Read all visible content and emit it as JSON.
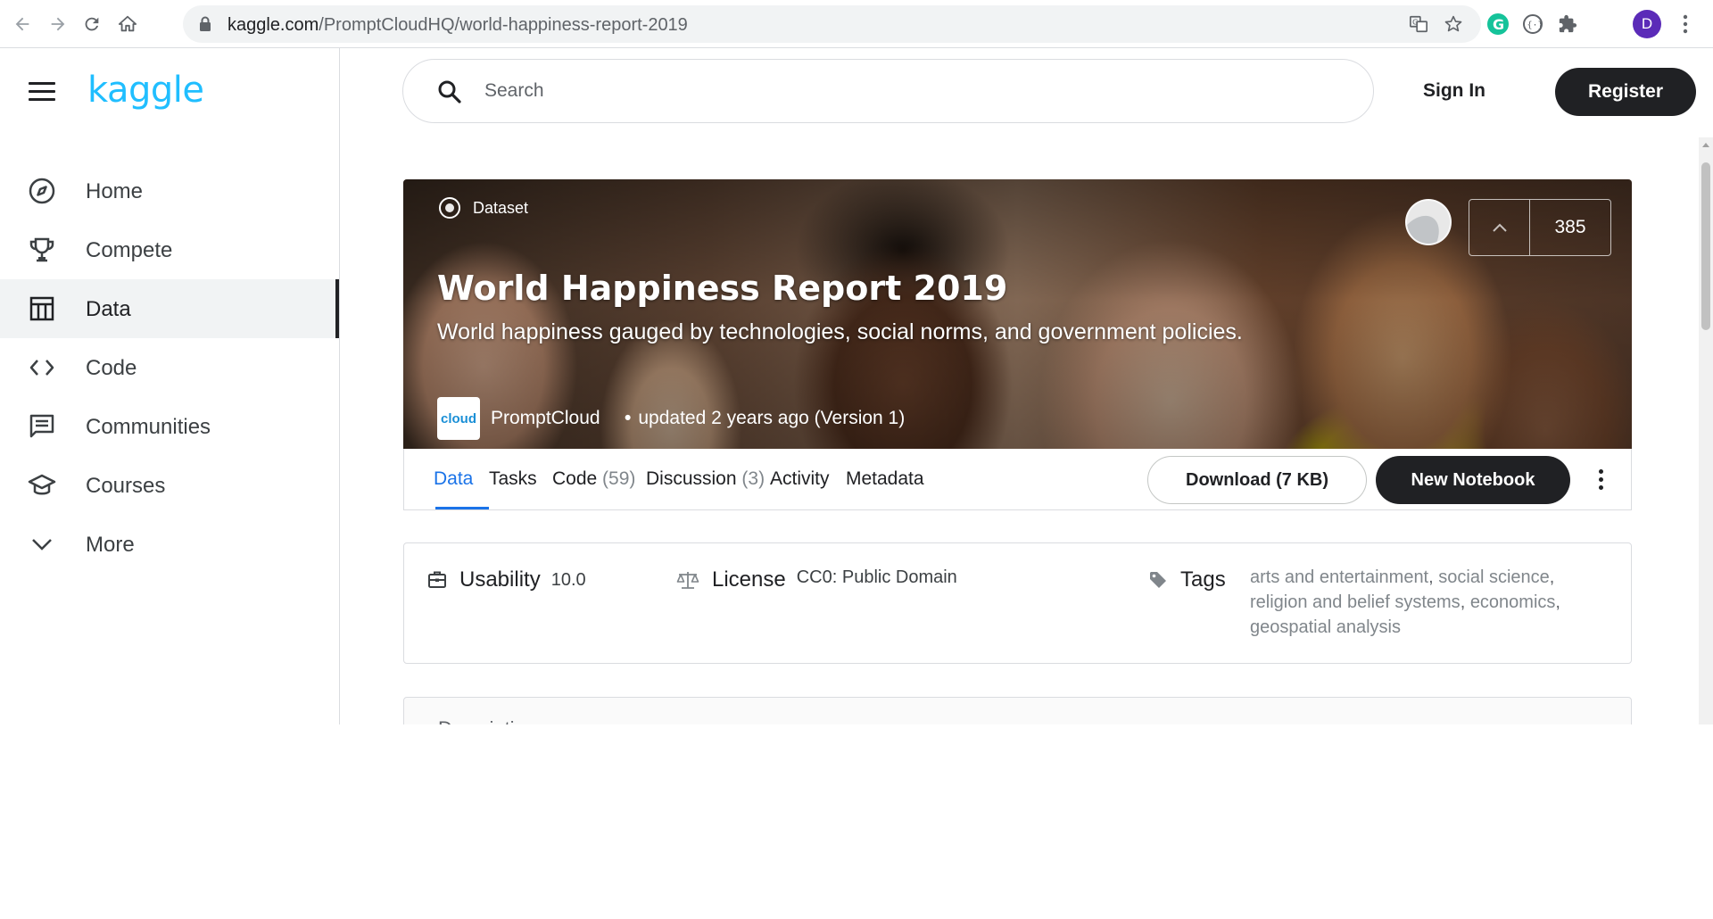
{
  "browser": {
    "url_host": "kaggle.com",
    "url_path": "/PromptCloudHQ/world-happiness-report-2019",
    "avatar_letter": "D"
  },
  "sidebar": {
    "logo": "kaggle",
    "items": [
      {
        "label": "Home",
        "icon": "compass-icon"
      },
      {
        "label": "Compete",
        "icon": "trophy-icon"
      },
      {
        "label": "Data",
        "icon": "table-icon",
        "active": true
      },
      {
        "label": "Code",
        "icon": "code-brackets-icon"
      },
      {
        "label": "Communities",
        "icon": "chat-icon"
      },
      {
        "label": "Courses",
        "icon": "graduation-cap-icon"
      },
      {
        "label": "More",
        "icon": "chevron-down-icon"
      }
    ]
  },
  "topbar": {
    "search_placeholder": "Search",
    "signin_label": "Sign In",
    "register_label": "Register"
  },
  "dataset": {
    "type_label": "Dataset",
    "title": "World Happiness Report 2019",
    "subtitle": "World happiness gauged by technologies, social norms, and government policies.",
    "owner": "PromptCloud",
    "owner_logo_text": "cloud",
    "updated": "updated 2 years ago (Version 1)",
    "votes": "385"
  },
  "tabs": [
    {
      "label": "Data",
      "count": ""
    },
    {
      "label": "Tasks",
      "count": ""
    },
    {
      "label": "Code",
      "count": "(59)"
    },
    {
      "label": "Discussion",
      "count": "(3)"
    },
    {
      "label": "Activity",
      "count": ""
    },
    {
      "label": "Metadata",
      "count": ""
    }
  ],
  "actions": {
    "download_label": "Download (7 KB)",
    "new_notebook_label": "New Notebook"
  },
  "meta": {
    "usability_label": "Usability",
    "usability_value": "10.0",
    "license_label": "License",
    "license_value": "CC0: Public Domain",
    "tags_label": "Tags",
    "tags": [
      "arts and entertainment",
      "social science",
      "religion and belief systems",
      "economics",
      "geospatial analysis"
    ]
  },
  "description": {
    "title": "Description"
  },
  "colors": {
    "kaggle_blue": "#20beff",
    "active_tab": "#1a73e8",
    "button_dark": "#202124"
  }
}
